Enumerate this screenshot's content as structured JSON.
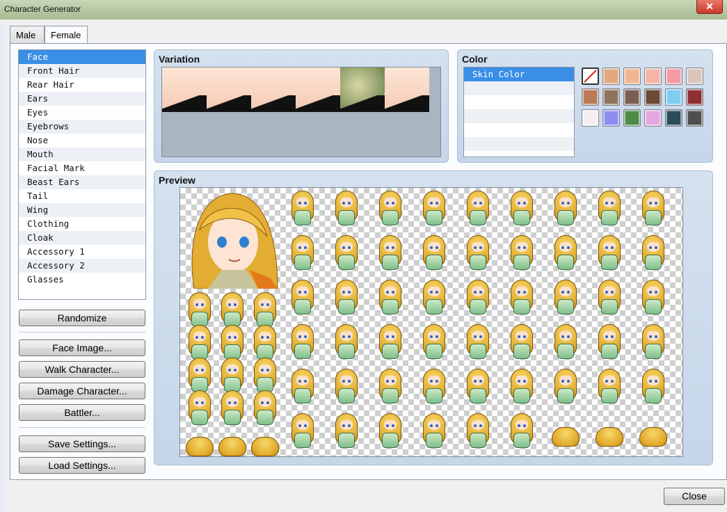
{
  "window": {
    "title": "Character Generator",
    "close_glyph": "✕"
  },
  "tabs": [
    {
      "label": "Male"
    },
    {
      "label": "Female"
    }
  ],
  "parts": [
    "Face",
    "Front Hair",
    "Rear Hair",
    "Ears",
    "Eyes",
    "Eyebrows",
    "Nose",
    "Mouth",
    "Facial Mark",
    "Beast Ears",
    "Tail",
    "Wing",
    "Clothing",
    "Cloak",
    "Accessory 1",
    "Accessory 2",
    "Glasses"
  ],
  "buttons": {
    "randomize": "Randomize",
    "face_image": "Face Image...",
    "walk_character": "Walk Character...",
    "damage_character": "Damage Character...",
    "battler": "Battler...",
    "save_settings": "Save Settings...",
    "load_settings": "Load Settings...",
    "close": "Close"
  },
  "variation": {
    "title": "Variation",
    "selected_index": 0,
    "count": 6
  },
  "color": {
    "title": "Color",
    "items": [
      "Skin Color"
    ],
    "palette": [
      "none",
      "#e3a77c",
      "#f3b491",
      "#f7b3a6",
      "#f69aa5",
      "#dcc4b8",
      "#b97a55",
      "#8f735f",
      "#7b5e53",
      "#6b4a36",
      "#7fcdf2",
      "#8e2f32",
      "#f4eef2",
      "#8e8df2",
      "#4f8a47",
      "#e5a6dd",
      "#2c4c59",
      "#4f4f4f"
    ]
  },
  "preview": {
    "title": "Preview"
  }
}
